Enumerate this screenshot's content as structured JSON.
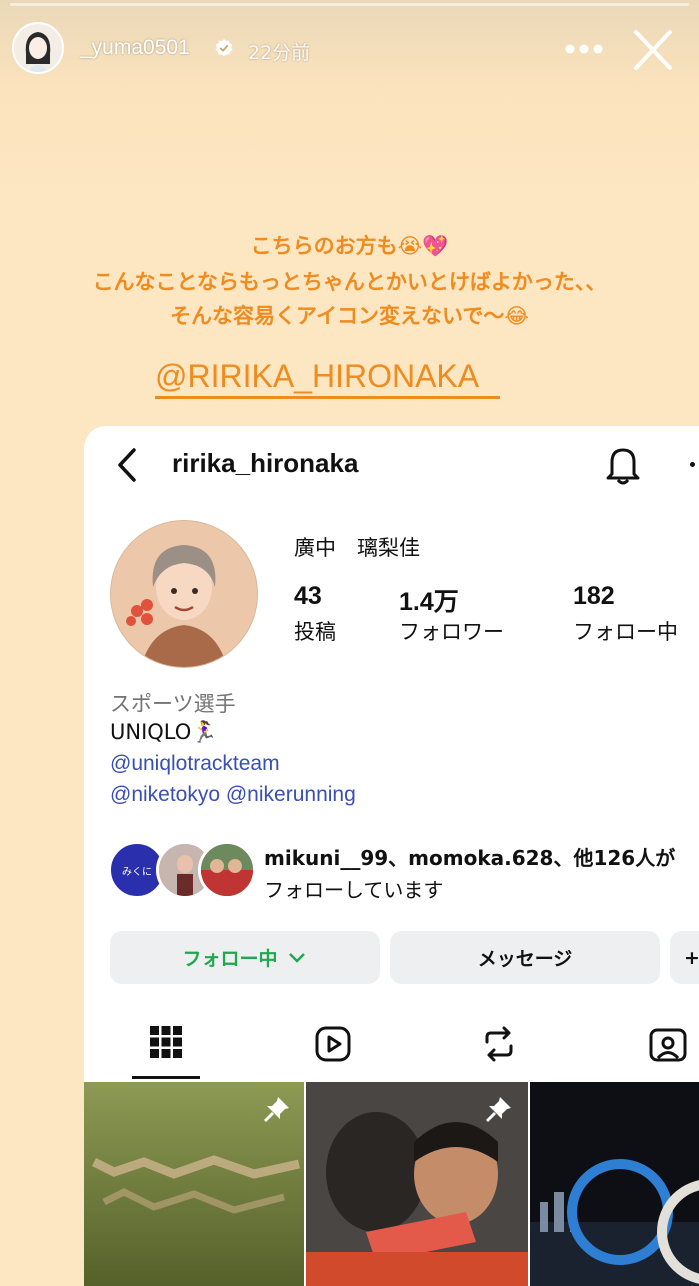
{
  "story": {
    "username": "_yuma0501",
    "time_ago": "22分前",
    "caption_lines": [
      "こちらのお方も😭💖",
      "こんなことならもっとちゃんとかいとけばよかった、、",
      "そんな容易くアイコン変えないで〜😂"
    ],
    "mention": "@RIRIKA_HIRONAKA"
  },
  "profile": {
    "username": "ririka_hironaka",
    "name": "廣中　璃梨佳",
    "stats": [
      {
        "value": "43",
        "label": "投稿"
      },
      {
        "value": "1.4万",
        "label": "フォロワー"
      },
      {
        "value": "182",
        "label": "フォロー中"
      }
    ],
    "category": "スポーツ選手",
    "bio": "UNIQLO🏃‍♀️",
    "links": [
      "@uniqlotrackteam",
      "@niketokyo @nikerunning"
    ],
    "followed_by_line1": "mikuni__99、momoka.628、他126人が",
    "followed_by_line2": "フォローしています",
    "mutual_avatar_text": "みくに",
    "follow_button": "フォロー中",
    "message_button": "メッセージ",
    "extra_button": "+"
  },
  "colors": {
    "accent": "#ef8b1f",
    "link": "#3a4fb6",
    "following_green": "#1fa84f",
    "story_bg": "#fde6c2"
  }
}
